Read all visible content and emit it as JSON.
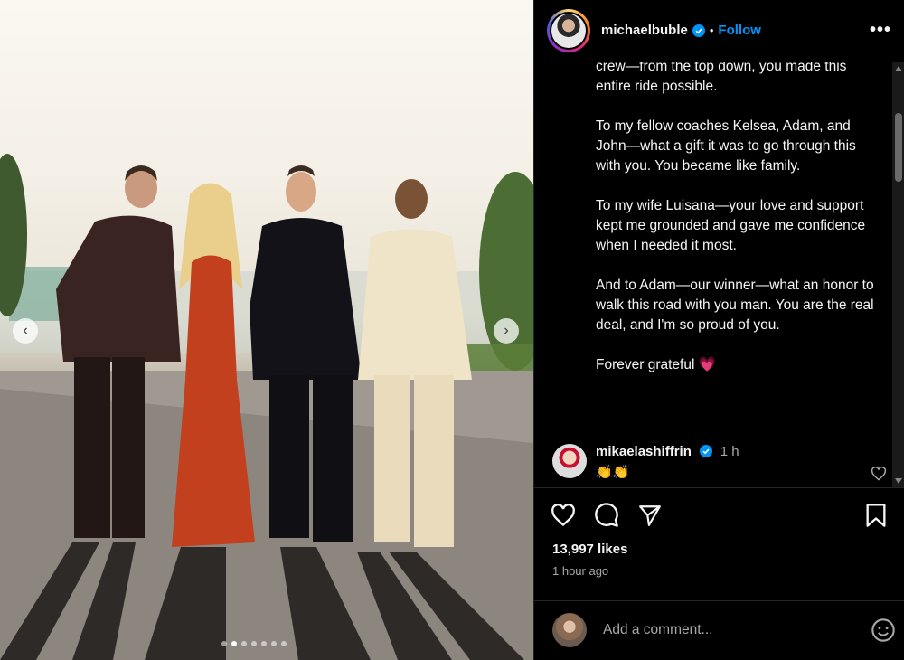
{
  "post": {
    "username": "michaelbuble",
    "follow_label": "Follow",
    "separator": "•",
    "more_label": "•••",
    "caption_lines": [
      "crew—from the top down, you made this entire ride possible.",
      "To my fellow coaches Kelsea, Adam, and John—what a gift it was to go through this with you. You became like family.",
      "To my wife Luisana—your love and support kept me grounded and gave me confidence when I needed it most.",
      "And to Adam—our winner—what an honor to walk this road with you man. You are the real deal, and I'm so proud of you.",
      "Forever grateful"
    ],
    "caption_emoji": "💗"
  },
  "comment": {
    "username": "mikaelashiffrin",
    "time": "1 h",
    "text": "👏👏"
  },
  "stats": {
    "likes": "13,997 likes",
    "time_ago": "1 hour ago"
  },
  "add_comment": {
    "placeholder": "Add a comment..."
  },
  "carousel": {
    "count": 7,
    "active_index": 1
  },
  "colors": {
    "accent": "#0095f6",
    "verified": "#0095f6",
    "background": "#000000"
  },
  "icons": [
    "verified-badge-icon",
    "more-options-icon",
    "heart-icon",
    "comment-icon",
    "share-icon",
    "bookmark-icon",
    "emoji-icon",
    "chevron-left-icon",
    "chevron-right-icon"
  ]
}
